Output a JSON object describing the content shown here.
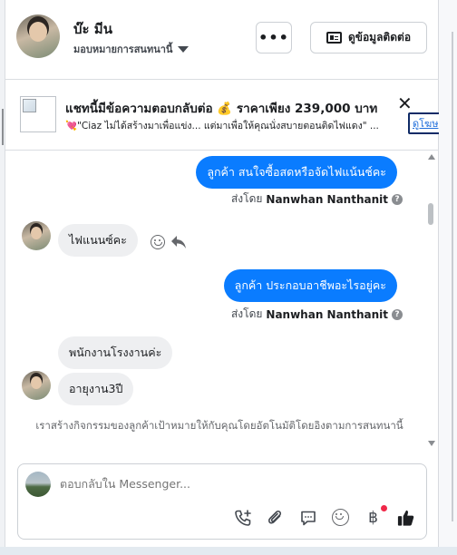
{
  "header": {
    "name": "บ๊ะ มีน",
    "assign_label": "มอบหมายการสนทนานี้",
    "more_label": "•••",
    "contact_label": "ดูข้อมูลติดต่อ"
  },
  "ad": {
    "title": "แชทนี้มีข้อความตอบกลับต่อ 💰 ราคาเพียง 239,000 บาท",
    "subtitle": "💘\"Ciaz ไม่ได้สร้างมาเพื่อแข่ง... แต่มาเพื่อให้คุณนั่งสบายตอนติดไฟแดง\" ...",
    "close_label": "✕",
    "more_link": "ดูโฆษ"
  },
  "messages": [
    {
      "direction": "out",
      "text": "ลูกค้า สนใจซื้อสดหรือจัดไฟแน้นช์คะ",
      "sent_prefix": "ส่งโดย",
      "sender": "Nanwhan Nanthanit"
    },
    {
      "direction": "in",
      "text": "ไฟแนนซ์คะ"
    },
    {
      "direction": "out",
      "text": "ลูกค้า ประกอบอาชีพอะไรอยู่คะ",
      "sent_prefix": "ส่งโดย",
      "sender": "Nanwhan Nanthanit"
    },
    {
      "direction": "in",
      "text": "พนักงานโรงงานค่ะ"
    },
    {
      "direction": "in",
      "text": "อายุงาน3ปี"
    }
  ],
  "help_glyph": "?",
  "info_note": "เราสร้างกิจกรรมของลูกค้าเป้าหมายให้กับคุณโดยอัตโนมัติโดยอิงตามการสนทนานี้",
  "composer": {
    "placeholder": "ตอบกลับใน Messenger...",
    "baht_glyph": "฿"
  },
  "colors": {
    "outgoing_bubble": "#0a7cff",
    "incoming_bubble": "#eeeff1",
    "notification_dot": "#f02849"
  },
  "icons": [
    "caret-down-icon",
    "contact-card-icon",
    "close-icon",
    "smiley-icon",
    "reply-icon",
    "phone-add-icon",
    "attachment-icon",
    "chat-bubble-icon",
    "emoji-icon",
    "baht-icon",
    "thumbs-up-icon"
  ]
}
